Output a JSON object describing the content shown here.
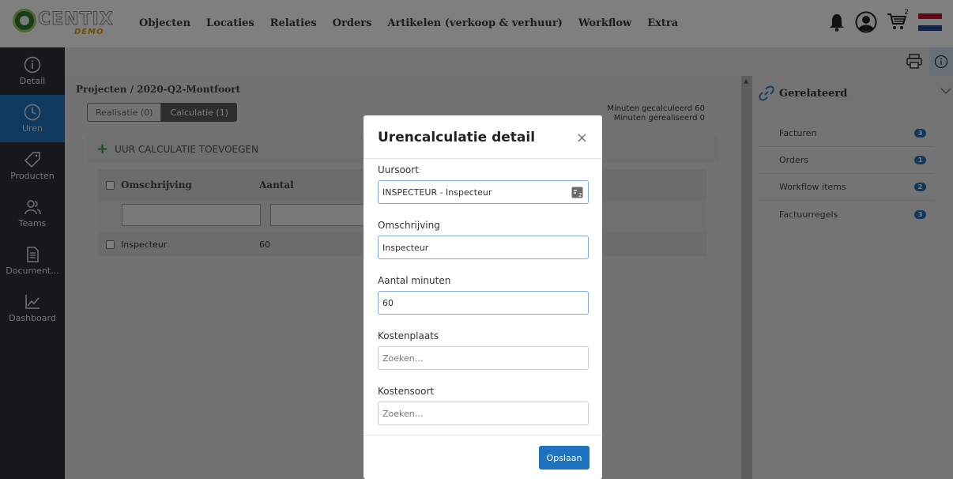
{
  "logo": {
    "text": "CENTIX",
    "sub": "DEMO"
  },
  "nav": [
    "Objecten",
    "Locaties",
    "Relaties",
    "Orders",
    "Artikelen (verkoop & verhuur)",
    "Workflow",
    "Extra"
  ],
  "header_icons": {
    "bell": "bell-icon",
    "user": "user-icon",
    "cart": "cart-icon",
    "cart_count": "2",
    "flag": "flag-nl-icon"
  },
  "sidebar": [
    {
      "label": "Detail",
      "icon": "info-icon"
    },
    {
      "label": "Uren",
      "icon": "clock-icon",
      "active": true
    },
    {
      "label": "Producten",
      "icon": "tag-icon"
    },
    {
      "label": "Teams",
      "icon": "team-icon"
    },
    {
      "label": "Document...",
      "icon": "document-icon"
    },
    {
      "label": "Dashboard",
      "icon": "chart-icon"
    }
  ],
  "breadcrumb": "Projecten / 2020-Q2-Montfoort",
  "tabs": [
    {
      "label": "Realisatie (0)",
      "active": false
    },
    {
      "label": "Calculatie (1)",
      "active": true
    }
  ],
  "minutes": {
    "calculated": "Minuten gecalculeerd 60",
    "realized": "Minuten gerealiseerd 0"
  },
  "add_button": "UUR CALCULATIE TOEVOEGEN",
  "grid": {
    "headers": [
      "Omschrijving",
      "Aantal"
    ],
    "rows": [
      {
        "omschrijving": "Inspecteur",
        "aantal": "60"
      }
    ]
  },
  "related": {
    "title": "Gerelateerd",
    "items": [
      {
        "label": "Facturen",
        "count": "3"
      },
      {
        "label": "Orders",
        "count": "1"
      },
      {
        "label": "Workflow items",
        "count": "2"
      },
      {
        "label": "Factuurregels",
        "count": "3"
      }
    ]
  },
  "modal": {
    "title": "Urencalculatie detail",
    "close": "×",
    "fields": {
      "uursoort": {
        "label": "Uursoort",
        "value": "INSPECTEUR - Inspecteur"
      },
      "omschrijving": {
        "label": "Omschrijving",
        "value": "Inspecteur"
      },
      "aantal": {
        "label": "Aantal minuten",
        "value": "60"
      },
      "kostenplaats": {
        "label": "Kostenplaats",
        "placeholder": "Zoeken..."
      },
      "kostensoort": {
        "label": "Kostensoort",
        "placeholder": "Zoeken..."
      }
    },
    "save": "Opslaan"
  },
  "colors": {
    "accent": "#1e73be",
    "sidebar": "#2f3136",
    "add_green": "#2e9e2e",
    "flag_red": "#c8102e",
    "flag_blue": "#21468b"
  }
}
